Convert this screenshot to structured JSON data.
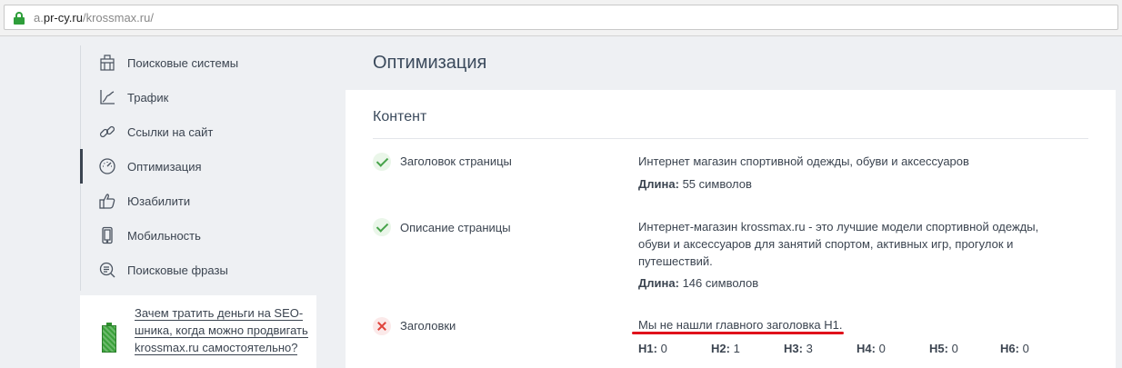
{
  "browser": {
    "url_prefix": "a.",
    "url_domain": "pr-cy.ru",
    "url_path": "/krossmax.ru/"
  },
  "sidebar": {
    "items": [
      {
        "label": "Поисковые системы",
        "icon": "search-engines-icon"
      },
      {
        "label": "Трафик",
        "icon": "traffic-chart-icon"
      },
      {
        "label": "Ссылки на сайт",
        "icon": "link-icon"
      },
      {
        "label": "Оптимизация",
        "icon": "speedometer-icon",
        "active": true
      },
      {
        "label": "Юзабилити",
        "icon": "thumbs-up-icon"
      },
      {
        "label": "Мобильность",
        "icon": "mobile-phone-icon"
      },
      {
        "label": "Поисковые фразы",
        "icon": "search-phrases-icon"
      }
    ]
  },
  "promo": {
    "text": "Зачем тратить деньги на SEO-шника, когда можно продвигать krossmax.ru самостоятельно?"
  },
  "main": {
    "title": "Оптимизация",
    "panel_title": "Контент",
    "rows": [
      {
        "status": "ok",
        "label": "Заголовок страницы",
        "value": "Интернет магазин спортивной одежды, обуви и аксессуаров",
        "meta_label": "Длина:",
        "meta_value": "55 символов"
      },
      {
        "status": "ok",
        "label": "Описание страницы",
        "value": "Интернет-магазин krossmax.ru - это лучшие модели спортивной одежды, обуви и аксессуаров для занятий спортом, активных игр, прогулок и путешествий.",
        "meta_label": "Длина:",
        "meta_value": "146 символов"
      },
      {
        "status": "error",
        "label": "Заголовки",
        "value": "Мы не нашли главного заголовка H1."
      }
    ],
    "headings": [
      {
        "label": "H1:",
        "value": "0"
      },
      {
        "label": "H2:",
        "value": "1"
      },
      {
        "label": "H3:",
        "value": "3"
      },
      {
        "label": "H4:",
        "value": "0"
      },
      {
        "label": "H5:",
        "value": "0"
      },
      {
        "label": "H6:",
        "value": "0"
      }
    ]
  },
  "colors": {
    "accent_green": "#47a34a",
    "error_red": "#e0443c",
    "underline_red": "#e0121b"
  }
}
